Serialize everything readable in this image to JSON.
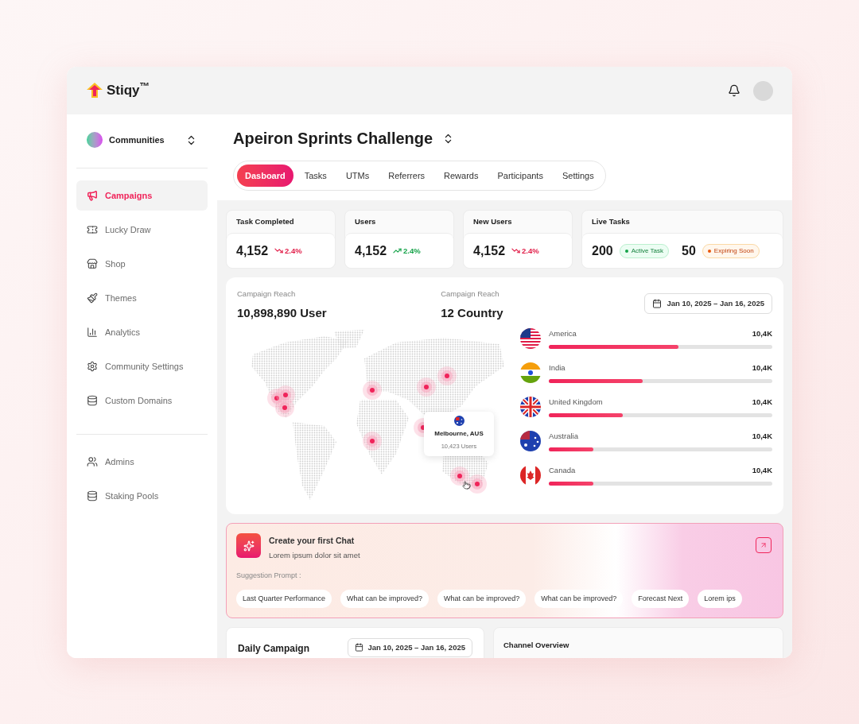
{
  "brand": {
    "name": "Stiqy$^{™}$"
  },
  "sidebar": {
    "community": "Communities",
    "groups": [
      [
        {
          "label": "Campaigns",
          "kind": "megaphone",
          "selected": true
        },
        {
          "label": "Lucky Draw",
          "kind": "ticket",
          "selected": false
        },
        {
          "label": "Shop",
          "kind": "store",
          "selected": false
        },
        {
          "label": "Themes",
          "kind": "brush",
          "selected": false
        },
        {
          "label": "Analytics",
          "kind": "chart",
          "selected": false
        },
        {
          "label": "Community Settings",
          "kind": "gear",
          "selected": false
        },
        {
          "label": "Custom Domains",
          "kind": "stack",
          "selected": false
        }
      ],
      [
        {
          "label": "Admins",
          "kind": "users",
          "selected": false
        },
        {
          "label": "Staking Pools",
          "kind": "stack",
          "selected": false
        }
      ]
    ]
  },
  "title": "Apeiron Sprints Challenge",
  "tabs": [
    {
      "label": "Dasboard",
      "selected": true
    },
    {
      "label": "Tasks",
      "selected": false
    },
    {
      "label": "UTMs",
      "selected": false
    },
    {
      "label": "Referrers",
      "selected": false
    },
    {
      "label": "Rewards",
      "selected": false
    },
    {
      "label": "Participants",
      "selected": false
    },
    {
      "label": "Settings",
      "selected": false
    }
  ],
  "stats": [
    {
      "kind": "down",
      "label": "Task Completed",
      "value": "4,152",
      "change": "2.4%"
    },
    {
      "kind": "up",
      "label": "Users",
      "value": "4,152",
      "change": "2.4%"
    },
    {
      "kind": "down",
      "label": "New Users",
      "value": "4,152",
      "change": "2.4%"
    },
    {
      "kind": "live",
      "label": "Live Tasks",
      "items": [
        {
          "value": "200",
          "badge": "Active Task",
          "kind": "active",
          "color": "#16a34a"
        },
        {
          "value": "50",
          "badge": "Expiring Soon",
          "kind": "expiring",
          "color": "#ea580c"
        }
      ]
    }
  ],
  "reach": {
    "metrics": [
      {
        "label": "Campaign Reach",
        "value": "10,898,890 User"
      },
      {
        "label": "Campaign Reach",
        "value": "12 Country"
      }
    ],
    "date_range": "Jan 10, 2025 – Jan 16, 2025",
    "tooltip": {
      "place": "Melbourne, AUS",
      "users": "10,423 Users"
    },
    "countries": [
      {
        "name": "America",
        "kind": "us",
        "value": "10,4K",
        "level": 0.58
      },
      {
        "name": "India",
        "kind": "in",
        "value": "10,4K",
        "level": 0.42
      },
      {
        "name": "United Kingdom",
        "kind": "gb",
        "value": "10,4K",
        "level": 0.33
      },
      {
        "name": "Australia",
        "kind": "au",
        "value": "10,4K",
        "level": 0.2
      },
      {
        "name": "Canada",
        "kind": "ca",
        "value": "10,4K",
        "level": 0.2
      }
    ]
  },
  "chat": {
    "title": "Create your first Chat",
    "subtitle": "Lorem ipsum dolor sit amet",
    "prompt_label": "Suggestion Prompt :",
    "prompts": [
      "Last Quarter Performance",
      "What can be improved?",
      "What can be improved?",
      "What can be improved?",
      "Forecast Next",
      "Lorem ips"
    ]
  },
  "daily": {
    "title": "Daily Campaign",
    "date_range": "Jan 10, 2025 – Jan 16, 2025"
  },
  "channel": {
    "title": "Channel Overview"
  }
}
